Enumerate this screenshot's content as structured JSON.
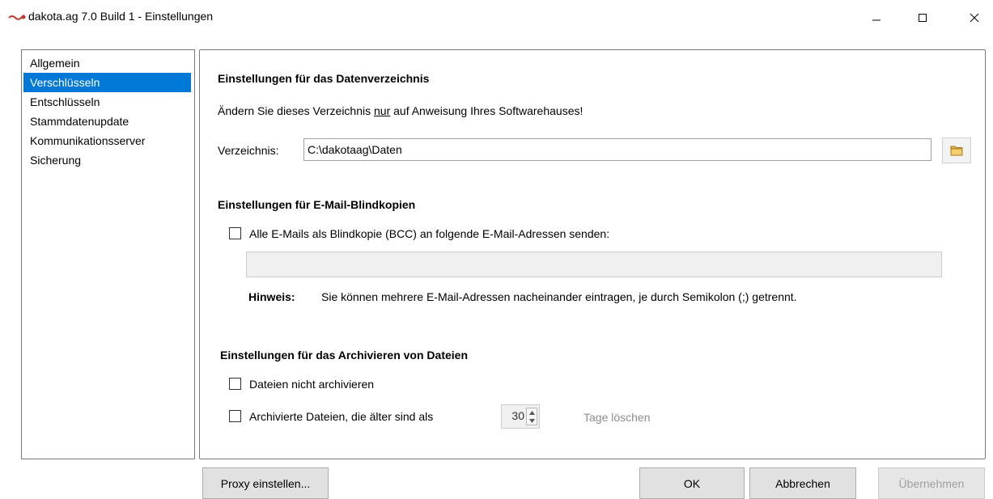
{
  "window": {
    "title": "dakota.ag 7.0 Build 1 - Einstellungen",
    "colors": {
      "accent": "#0078d7",
      "border": "#7a7a7a",
      "button_bg": "#e1e1e1",
      "disabled_text": "#8c8c8c"
    }
  },
  "nav": {
    "items": [
      {
        "label": "Allgemein"
      },
      {
        "label": "Verschlüsseln",
        "selected": true
      },
      {
        "label": "Entschlüsseln"
      },
      {
        "label": "Stammdatenupdate"
      },
      {
        "label": "Kommunikationsserver"
      },
      {
        "label": "Sicherung"
      }
    ]
  },
  "data_dir": {
    "heading": "Einstellungen für das Datenverzeichnis",
    "notice_before": "Ändern Sie dieses Verzeichnis ",
    "notice_underlined": "nur",
    "notice_after": " auf Anweisung Ihres Softwarehauses!",
    "label": "Verzeichnis:",
    "value": "C:\\dakotaag\\Daten",
    "browse_icon": "folder-icon"
  },
  "bcc": {
    "heading": "Einstellungen für E-Mail-Blindkopien",
    "checkbox_label": "Alle E-Mails als Blindkopie (BCC) an folgende E-Mail-Adressen senden:",
    "checked": false,
    "address_value": "",
    "hint_label": "Hinweis:",
    "hint_text": "Sie können mehrere E-Mail-Adressen nacheinander eintragen, je durch Semikolon (;) getrennt."
  },
  "archive": {
    "heading": "Einstellungen für das Archivieren von Dateien",
    "no_archive_label": "Dateien nicht archivieren",
    "no_archive_checked": false,
    "delete_label": "Archivierte Dateien, die älter sind als",
    "delete_checked": false,
    "days_value": "30",
    "days_suffix": "Tage löschen"
  },
  "buttons": {
    "proxy": "Proxy einstellen...",
    "ok": "OK",
    "cancel": "Abbrechen",
    "apply": "Übernehmen"
  }
}
